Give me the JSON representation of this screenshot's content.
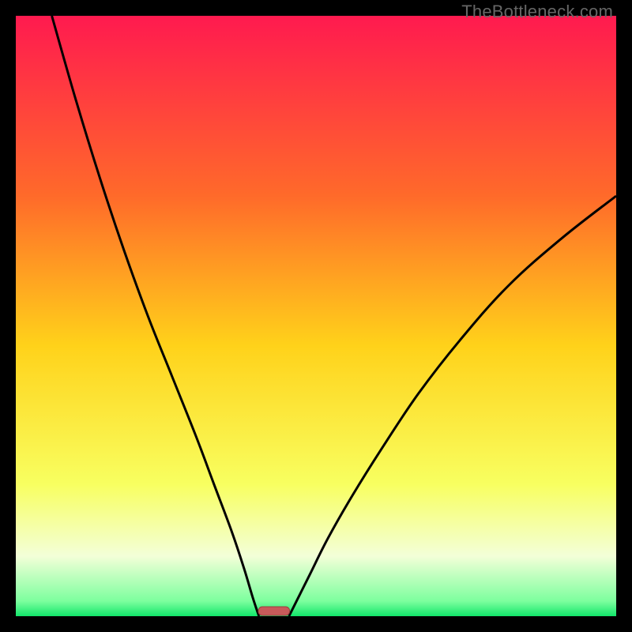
{
  "watermark": "TheBottleneck.com",
  "colors": {
    "top": "#ff1a4f",
    "upper_mid": "#ff7a2a",
    "mid": "#ffd21a",
    "lower_mid": "#f8ff60",
    "pale": "#f3ffd8",
    "green": "#12e66a",
    "curve": "#000000",
    "marker_fill": "#c85a5a",
    "marker_stroke": "#9c3f3f",
    "frame": "#000000"
  },
  "chart_data": {
    "type": "line",
    "title": "",
    "xlabel": "",
    "ylabel": "",
    "xlim": [
      0,
      100
    ],
    "ylim": [
      0,
      100
    ],
    "gradient_stops": [
      {
        "offset": 0.0,
        "color": "#ff1a4f"
      },
      {
        "offset": 0.3,
        "color": "#ff6a2a"
      },
      {
        "offset": 0.55,
        "color": "#ffd21a"
      },
      {
        "offset": 0.78,
        "color": "#f8ff60"
      },
      {
        "offset": 0.9,
        "color": "#f3ffd8"
      },
      {
        "offset": 0.975,
        "color": "#7dff9e"
      },
      {
        "offset": 1.0,
        "color": "#12e66a"
      }
    ],
    "series": [
      {
        "name": "left-branch",
        "x": [
          6,
          10,
          14,
          18,
          22,
          26,
          30,
          33,
          36,
          38,
          39.5,
          40.5
        ],
        "y": [
          100,
          86,
          73,
          61,
          50,
          40,
          30,
          22,
          14,
          8,
          3,
          0
        ]
      },
      {
        "name": "right-branch",
        "x": [
          45.5,
          47,
          49,
          52,
          56,
          61,
          67,
          74,
          82,
          91,
          100
        ],
        "y": [
          0,
          3,
          7,
          13,
          20,
          28,
          37,
          46,
          55,
          63,
          70
        ]
      }
    ],
    "marker": {
      "x_center": 43,
      "x_halfwidth": 2.6,
      "y": 0.6
    },
    "annotations": []
  }
}
